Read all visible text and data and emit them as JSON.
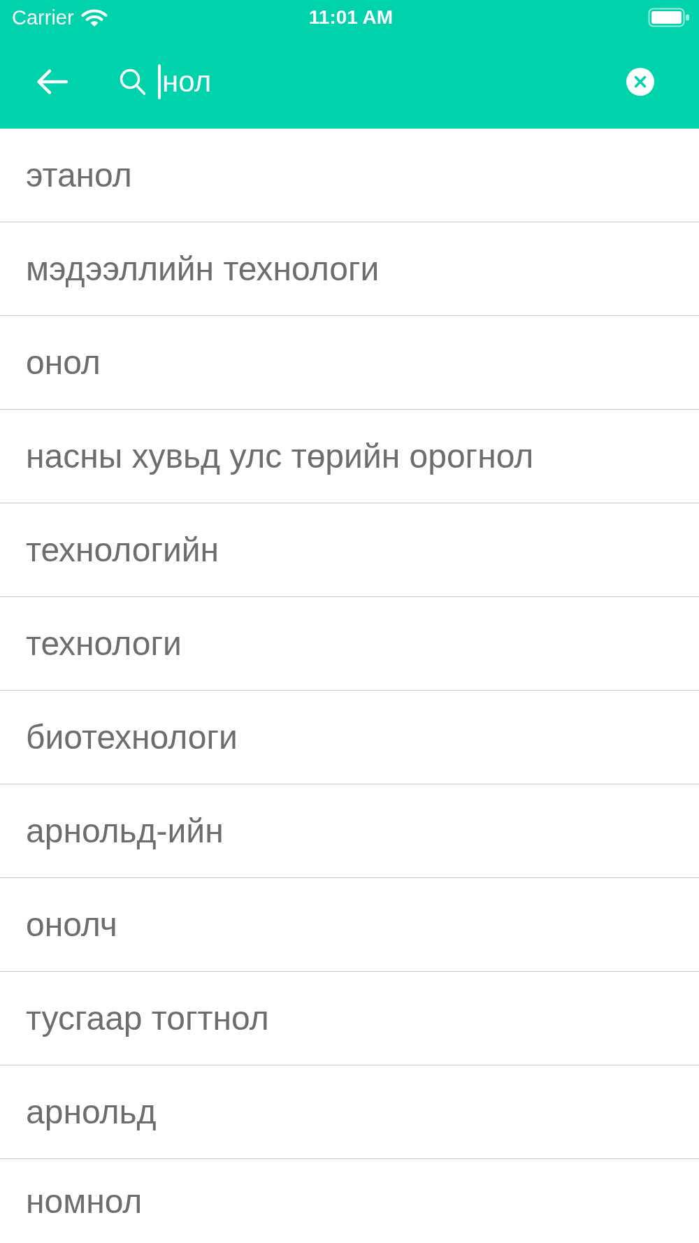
{
  "status_bar": {
    "carrier": "Carrier",
    "time": "11:01 AM"
  },
  "search": {
    "value": "нол"
  },
  "results": [
    {
      "text": "этанол"
    },
    {
      "text": "мэдээллийн технологи"
    },
    {
      "text": "онол"
    },
    {
      "text": "насны хувьд улс төрийн орогнол"
    },
    {
      "text": "технологийн"
    },
    {
      "text": "технологи"
    },
    {
      "text": "биотехнологи"
    },
    {
      "text": "арнольд-ийн"
    },
    {
      "text": "онолч"
    },
    {
      "text": "тусгаар тогтнол"
    },
    {
      "text": "арнольд"
    },
    {
      "text": "номнол"
    }
  ]
}
